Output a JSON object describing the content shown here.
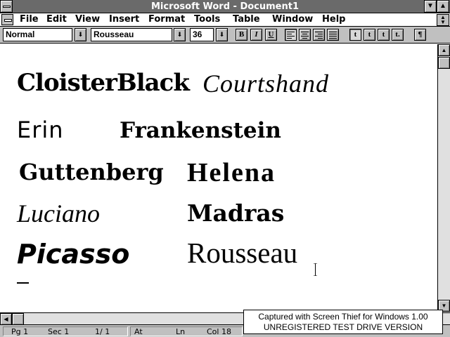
{
  "window": {
    "title": "Microsoft Word - Document1"
  },
  "menu": [
    "File",
    "Edit",
    "View",
    "Insert",
    "Format",
    "Tools",
    "Table",
    "Window",
    "Help"
  ],
  "ribbon": {
    "style": "Normal",
    "font": "Rousseau",
    "size": "36",
    "bold_label": "B",
    "italic_label": "I",
    "underline_label": "U",
    "tab_labels": [
      "t",
      "t",
      "t",
      "t."
    ],
    "show_marks_label": "¶"
  },
  "document": {
    "fonts": [
      "CloisterBlack",
      "Courtshand",
      "Erin",
      "Frankenstein",
      "Guttenberg",
      "Helena",
      "Luciano",
      "Madras",
      "Picasso",
      "Rousseau"
    ]
  },
  "status": {
    "page": "Pg 1",
    "section": "Sec 1",
    "pages": "1/ 1",
    "at": "At",
    "line": "Ln",
    "col": "Col 18"
  },
  "watermark": {
    "line1": "Captured with Screen Thief for Windows 1.00",
    "line2": "UNREGISTERED TEST DRIVE VERSION"
  }
}
